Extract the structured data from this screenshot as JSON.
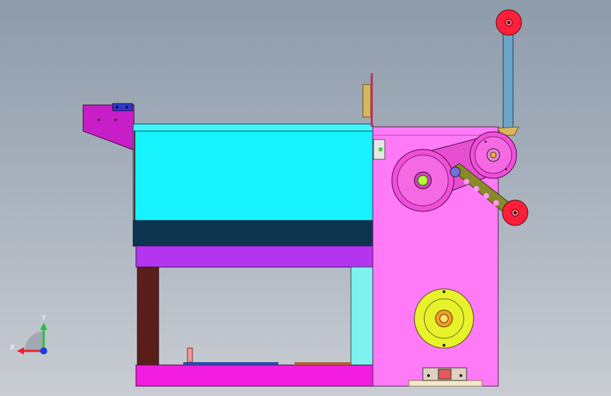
{
  "viewport": {
    "background_top": "#8e9bab",
    "background_bottom": "#c9cdd3"
  },
  "triad": {
    "x_label": "X",
    "y_label": "Y",
    "x_color": "#e8202a",
    "y_color": "#27c03a",
    "z_color": "#1a3ce0"
  },
  "colors": {
    "hopper": "#17f2ff",
    "conveyor_belt": "#0e3550",
    "frame_purple": "#b435f0",
    "cabinet": "#ff7af7",
    "base": "#f21de0",
    "left_bracket": "#c81ec8",
    "leg_brown": "#5a1f1a",
    "pulley_pink": "#f04fd8",
    "idler_red": "#ff1f3a",
    "handwheel_yellow": "#e7f22a",
    "arm_olive": "#8a8a2a",
    "post_blue": "#6aa6c8"
  }
}
